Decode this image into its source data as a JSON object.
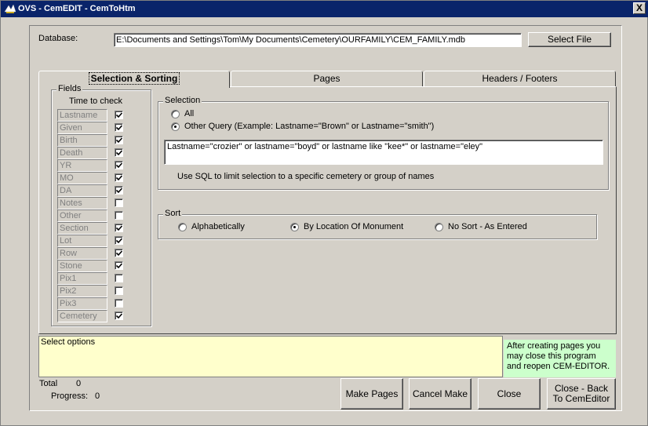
{
  "window": {
    "title": "OVS - CemEDIT - CemToHtm",
    "close_glyph": "X"
  },
  "database": {
    "label": "Database:",
    "path": "E:\\Documents and Settings\\Tom\\My Documents\\Cemetery\\OURFAMILY\\CEM_FAMILY.mdb",
    "select_button": "Select File"
  },
  "tabs": [
    {
      "label": "Selection & Sorting",
      "active": true
    },
    {
      "label": "Pages",
      "active": false
    },
    {
      "label": "Headers / Footers",
      "active": false
    }
  ],
  "fields": {
    "group_label": "Fields",
    "header": "Time to check",
    "items": [
      {
        "name": "Lastname",
        "checked": true
      },
      {
        "name": "Given",
        "checked": true
      },
      {
        "name": "Birth",
        "checked": true
      },
      {
        "name": "Death",
        "checked": true
      },
      {
        "name": "YR",
        "checked": true
      },
      {
        "name": "MO",
        "checked": true
      },
      {
        "name": "DA",
        "checked": true
      },
      {
        "name": "Notes",
        "checked": false
      },
      {
        "name": "Other",
        "checked": false
      },
      {
        "name": "Section",
        "checked": true
      },
      {
        "name": "Lot",
        "checked": true
      },
      {
        "name": "Row",
        "checked": true
      },
      {
        "name": "Stone",
        "checked": true
      },
      {
        "name": "Pix1",
        "checked": false
      },
      {
        "name": "Pix2",
        "checked": false
      },
      {
        "name": "Pix3",
        "checked": false
      },
      {
        "name": "Cemetery",
        "checked": true
      }
    ]
  },
  "selection": {
    "group_label": "Selection",
    "option_all": "All",
    "option_other": "Other Query (Example: Lastname=\"Brown\" or Lastname=\"smith\")",
    "selected": "other",
    "query": "Lastname=\"crozier\" or lastname=\"boyd\" or lastname like \"kee*\" or lastname=\"eley\"",
    "hint": "Use SQL to limit selection to a specific cemetery or group of names"
  },
  "sort": {
    "group_label": "Sort",
    "options": [
      "Alphabetically",
      "By Location Of Monument",
      "No Sort - As Entered"
    ],
    "selected_index": 1
  },
  "status": {
    "message": "Select options",
    "note": "After creating pages you may close this program and reopen CEM-EDITOR.",
    "total_label": "Total",
    "total_value": "0",
    "progress_label": "Progress:",
    "progress_value": "0"
  },
  "buttons": {
    "make_pages": "Make Pages",
    "cancel_make": "Cancel Make",
    "close": "Close",
    "close_back": "Close - Back To CemEditor"
  }
}
